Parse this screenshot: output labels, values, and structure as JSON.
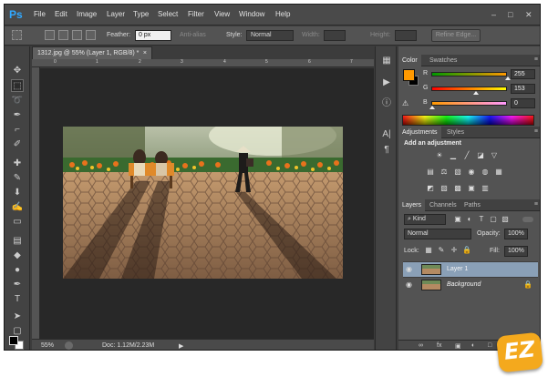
{
  "menubar": {
    "logo": "Ps",
    "items": [
      "File",
      "Edit",
      "Image",
      "Layer",
      "Type",
      "Select",
      "Filter",
      "View",
      "Window",
      "Help"
    ],
    "window_controls": [
      "–",
      "□",
      "✕"
    ]
  },
  "options": {
    "feather_label": "Feather:",
    "feather_value": "0 px",
    "antialias_label": "Anti-alias",
    "style_label": "Style:",
    "style_value": "Normal",
    "width_label": "Width:",
    "height_label": "Height:",
    "refine_label": "Refine Edge..."
  },
  "document": {
    "tab_title": "1312.jpg @ 55% (Layer 1, RGB/8) *",
    "close_icon": "×",
    "ruler_ticks": [
      "0",
      "1",
      "2",
      "3",
      "4",
      "5",
      "6",
      "7"
    ],
    "zoom": "55%",
    "doc_info": "Doc: 1.12M/2.23M",
    "play_icon": "▶"
  },
  "color_panel": {
    "tabs": [
      "Color",
      "Swatches"
    ],
    "foreground": "#ff9900",
    "r_label": "R",
    "r_value": "255",
    "g_label": "G",
    "g_value": "153",
    "b_label": "B",
    "b_value": "0"
  },
  "adjustments_panel": {
    "tabs": [
      "Adjustments",
      "Styles"
    ],
    "title": "Add an adjustment"
  },
  "layers_panel": {
    "tabs": [
      "Layers",
      "Channels",
      "Paths"
    ],
    "kind_label": "Kind",
    "blend_mode": "Normal",
    "opacity_label": "Opacity:",
    "opacity_value": "100%",
    "lock_label": "Lock:",
    "fill_label": "Fill:",
    "fill_value": "100%",
    "layers": [
      {
        "name": "Layer 1",
        "selected": true
      },
      {
        "name": "Background",
        "selected": false
      }
    ],
    "footer_icons": [
      "∞",
      "fx",
      "▣",
      "◐",
      "□",
      "▤",
      "🗑"
    ]
  },
  "watermark": {
    "text": "EZ"
  }
}
